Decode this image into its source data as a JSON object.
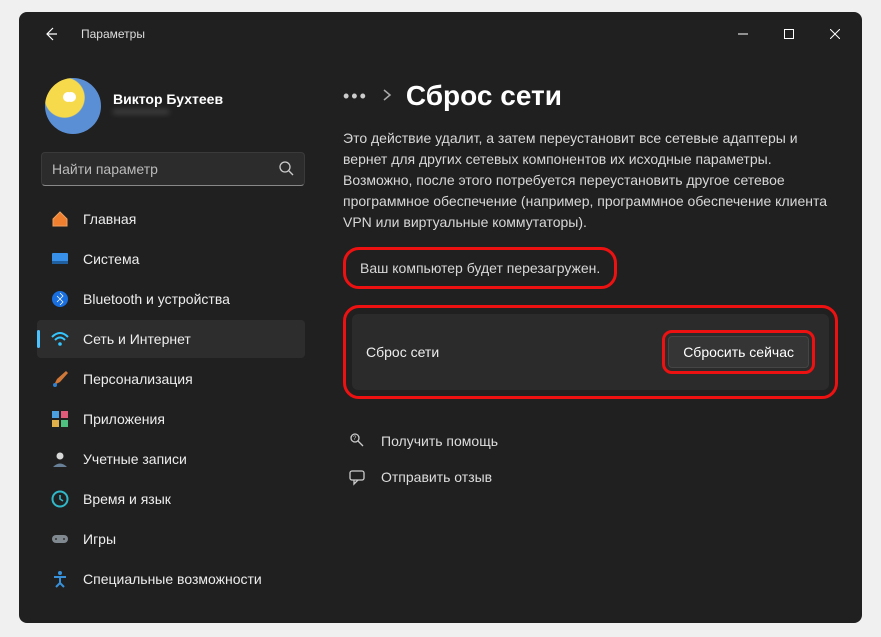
{
  "window": {
    "title": "Параметры"
  },
  "profile": {
    "name": "Виктор Бухтеев",
    "email": "************"
  },
  "search": {
    "placeholder": "Найти параметр"
  },
  "sidebar": {
    "items": [
      {
        "label": "Главная"
      },
      {
        "label": "Система"
      },
      {
        "label": "Bluetooth и устройства"
      },
      {
        "label": "Сеть и Интернет"
      },
      {
        "label": "Персонализация"
      },
      {
        "label": "Приложения"
      },
      {
        "label": "Учетные записи"
      },
      {
        "label": "Время и язык"
      },
      {
        "label": "Игры"
      },
      {
        "label": "Специальные возможности"
      }
    ]
  },
  "breadcrumb": {
    "ellipsis": "•••",
    "title": "Сброс сети"
  },
  "main": {
    "description": "Это действие удалит, а затем переустановит все сетевые адаптеры и вернет для других сетевых компонентов их исходные параметры. Возможно, после этого потребуется переустановить другое сетевое программное обеспечение (например, программное обеспечение клиента VPN или виртуальные коммутаторы).",
    "warning": "Ваш компьютер будет перезагружен.",
    "card_label": "Сброс сети",
    "reset_button": "Сбросить сейчас"
  },
  "footer": {
    "help": "Получить помощь",
    "feedback": "Отправить отзыв"
  }
}
